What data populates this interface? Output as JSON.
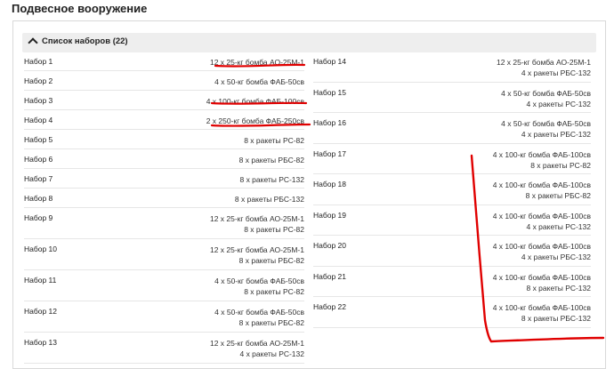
{
  "page": {
    "title": "Подвесное вооружение"
  },
  "panel": {
    "title": "Список наборов (22)"
  },
  "left_sets": [
    {
      "label": "Набор 1",
      "lines": [
        "12 x 25-кг бомба АО-25М-1"
      ]
    },
    {
      "label": "Набор 2",
      "lines": [
        "4 x 50-кг бомба ФАБ-50св"
      ]
    },
    {
      "label": "Набор 3",
      "lines": [
        "4 x 100-кг бомба ФАБ-100св"
      ]
    },
    {
      "label": "Набор 4",
      "lines": [
        "2 x 250-кг бомба ФАБ-250св"
      ]
    },
    {
      "label": "Набор 5",
      "lines": [
        "8 x ракеты РС-82"
      ]
    },
    {
      "label": "Набор 6",
      "lines": [
        "8 x ракеты РБС-82"
      ]
    },
    {
      "label": "Набор 7",
      "lines": [
        "8 x ракеты РС-132"
      ]
    },
    {
      "label": "Набор 8",
      "lines": [
        "8 x ракеты РБС-132"
      ]
    },
    {
      "label": "Набор 9",
      "lines": [
        "12 x 25-кг бомба АО-25М-1",
        "8 x ракеты РС-82"
      ]
    },
    {
      "label": "Набор 10",
      "lines": [
        "12 x 25-кг бомба АО-25М-1",
        "8 x ракеты РБС-82"
      ]
    },
    {
      "label": "Набор 11",
      "lines": [
        "4 x 50-кг бомба ФАБ-50св",
        "8 x ракеты РС-82"
      ]
    },
    {
      "label": "Набор 12",
      "lines": [
        "4 x 50-кг бомба ФАБ-50св",
        "8 x ракеты РБС-82"
      ]
    },
    {
      "label": "Набор 13",
      "lines": [
        "12 x 25-кг бомба АО-25М-1",
        "4 x ракеты РС-132"
      ]
    }
  ],
  "right_sets": [
    {
      "label": "Набор 14",
      "lines": [
        "12 x 25-кг бомба АО-25М-1",
        "4 x ракеты РБС-132"
      ]
    },
    {
      "label": "Набор 15",
      "lines": [
        "4 x 50-кг бомба ФАБ-50св",
        "4 x ракеты РС-132"
      ]
    },
    {
      "label": "Набор 16",
      "lines": [
        "4 x 50-кг бомба ФАБ-50св",
        "4 x ракеты РБС-132"
      ]
    },
    {
      "label": "Набор 17",
      "lines": [
        "4 x 100-кг бомба ФАБ-100св",
        "8 x ракеты РС-82"
      ]
    },
    {
      "label": "Набор 18",
      "lines": [
        "4 x 100-кг бомба ФАБ-100св",
        "8 x ракеты РБС-82"
      ]
    },
    {
      "label": "Набор 19",
      "lines": [
        "4 x 100-кг бомба ФАБ-100св",
        "4 x ракеты РС-132"
      ]
    },
    {
      "label": "Набор 20",
      "lines": [
        "4 x 100-кг бомба ФАБ-100св",
        "4 x ракеты РБС-132"
      ]
    },
    {
      "label": "Набор 21",
      "lines": [
        "4 x 100-кг бомба ФАБ-100св",
        "8 x ракеты РС-132"
      ]
    },
    {
      "label": "Набор 22",
      "lines": [
        "4 x 100-кг бомба ФАБ-100св",
        "8 x ракеты РБС-132"
      ]
    }
  ],
  "annotations": {
    "color": "#e00000"
  }
}
